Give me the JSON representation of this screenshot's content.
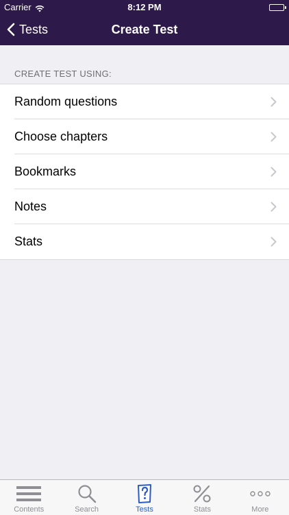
{
  "status_bar": {
    "carrier": "Carrier",
    "time": "8:12 PM"
  },
  "nav": {
    "back_label": "Tests",
    "title": "Create Test"
  },
  "section": {
    "header": "CREATE TEST USING:"
  },
  "list": {
    "items": [
      {
        "label": "Random questions"
      },
      {
        "label": "Choose chapters"
      },
      {
        "label": "Bookmarks"
      },
      {
        "label": "Notes"
      },
      {
        "label": "Stats"
      }
    ]
  },
  "tabbar": {
    "active_color": "#2a5cc4",
    "inactive_color": "#8e8e93",
    "tabs": [
      {
        "label": "Contents",
        "icon": "list-icon"
      },
      {
        "label": "Search",
        "icon": "search-icon"
      },
      {
        "label": "Tests",
        "icon": "question-scroll-icon",
        "active": true
      },
      {
        "label": "Stats",
        "icon": "percent-icon"
      },
      {
        "label": "More",
        "icon": "more-icon"
      }
    ]
  },
  "colors": {
    "header_bg": "#2e1a4a",
    "page_bg": "#efeff4",
    "section_text": "#6d6d72"
  }
}
